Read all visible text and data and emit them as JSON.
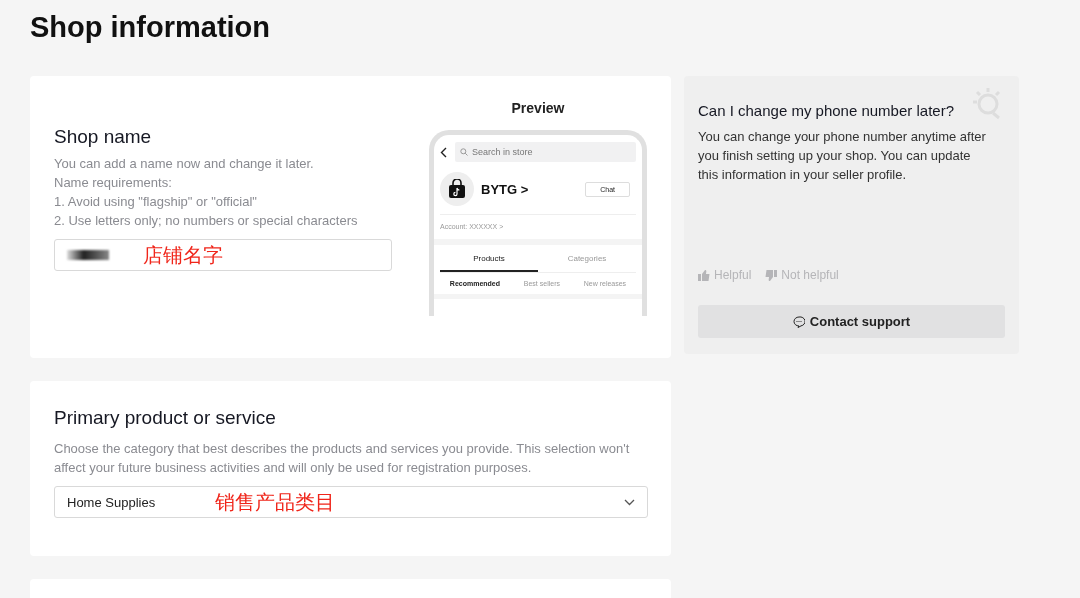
{
  "page_title": "Shop information",
  "shop_name": {
    "title": "Shop name",
    "description_lines": [
      "You can add a name now and change it later.",
      "Name requirements:",
      "1. Avoid using \"flagship\" or \"official\"",
      "2. Use letters only; no numbers or special characters"
    ],
    "annotation": "店铺名字"
  },
  "preview": {
    "title": "Preview",
    "search_placeholder": "Search in store",
    "shop_name": "BYTG",
    "shop_chevron": ">",
    "chat": "Chat",
    "account": "Account: XXXXXX >",
    "tabs": [
      {
        "label": "Products",
        "selected": true
      },
      {
        "label": "Categories",
        "selected": false
      }
    ],
    "filters": [
      {
        "label": "Recommended",
        "selected": true
      },
      {
        "label": "Best sellers",
        "selected": false
      },
      {
        "label": "New releases",
        "selected": false
      }
    ]
  },
  "primary_product": {
    "title": "Primary product or service",
    "description": "Choose the category that best describes the products and services you provide. This selection won't affect your future business activities and will only be used for registration purposes.",
    "value": "Home Supplies",
    "annotation": "销售产品类目"
  },
  "help": {
    "question": "Can I change my phone number later?",
    "answer": "You can change your phone number anytime after you finish setting up your shop. You can update this information in your seller profile.",
    "helpful": "Helpful",
    "not_helpful": "Not helpful",
    "contact": "Contact support"
  }
}
